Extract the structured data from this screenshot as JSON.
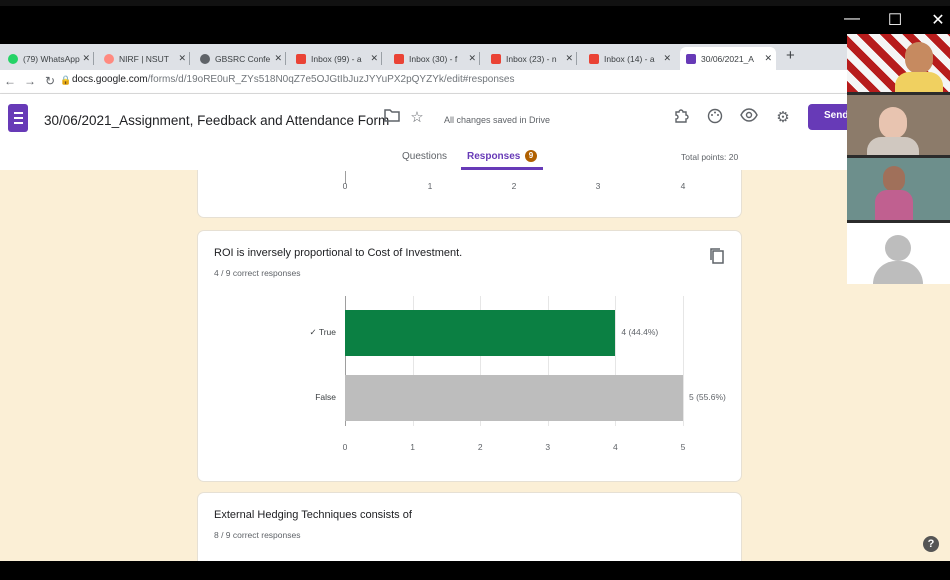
{
  "window": {
    "min": "—",
    "max": "☐",
    "close": "✕"
  },
  "tabs": [
    {
      "label": "(79) WhatsApp",
      "color": "#25d366"
    },
    {
      "label": "NIRF | NSUT",
      "color": "#ff8a80"
    },
    {
      "label": "GBSRC Confe",
      "color": "#5f6368"
    },
    {
      "label": "Inbox (99) - a",
      "color": "#ea4335"
    },
    {
      "label": "Inbox (30) - f",
      "color": "#ea4335"
    },
    {
      "label": "Inbox (23) - n",
      "color": "#ea4335"
    },
    {
      "label": "Inbox (14) - a",
      "color": "#ea4335"
    },
    {
      "label": "30/06/2021_A",
      "color": "#673ab7"
    }
  ],
  "new_tab": "+",
  "address": {
    "host": "docs.google.com",
    "path": "/forms/d/19oRE0uR_ZYs518N0qZ7e5OJGtIbJuzJYYuPX2pQYZYk/edit#responses"
  },
  "form": {
    "title": "30/06/2021_Assignment, Feedback and Attendance Form",
    "saved_status": "All changes saved in Drive",
    "send_label": "Send",
    "tab_questions": "Questions",
    "tab_responses": "Responses",
    "responses_count": "9",
    "total_points": "Total points: 20"
  },
  "prev_card": {
    "ticks": [
      "0",
      "1",
      "2",
      "3",
      "4"
    ]
  },
  "question_roi": {
    "title": "ROI is inversely proportional to Cost of Investment.",
    "correct": "4 / 9 correct responses"
  },
  "question_hedging": {
    "title": "External Hedging Techniques consists of",
    "correct": "8 / 9 correct responses"
  },
  "chart_data": {
    "type": "bar",
    "orientation": "horizontal",
    "categories": [
      "✓ True",
      "False"
    ],
    "values": [
      4,
      5
    ],
    "data_labels": [
      "4 (44.4%)",
      "5 (55.6%)"
    ],
    "colors": [
      "#0b8043",
      "#bdbdbd"
    ],
    "xlim": [
      0,
      5
    ],
    "xticks": [
      "0",
      "1",
      "2",
      "3",
      "4",
      "5"
    ]
  },
  "help": "?"
}
